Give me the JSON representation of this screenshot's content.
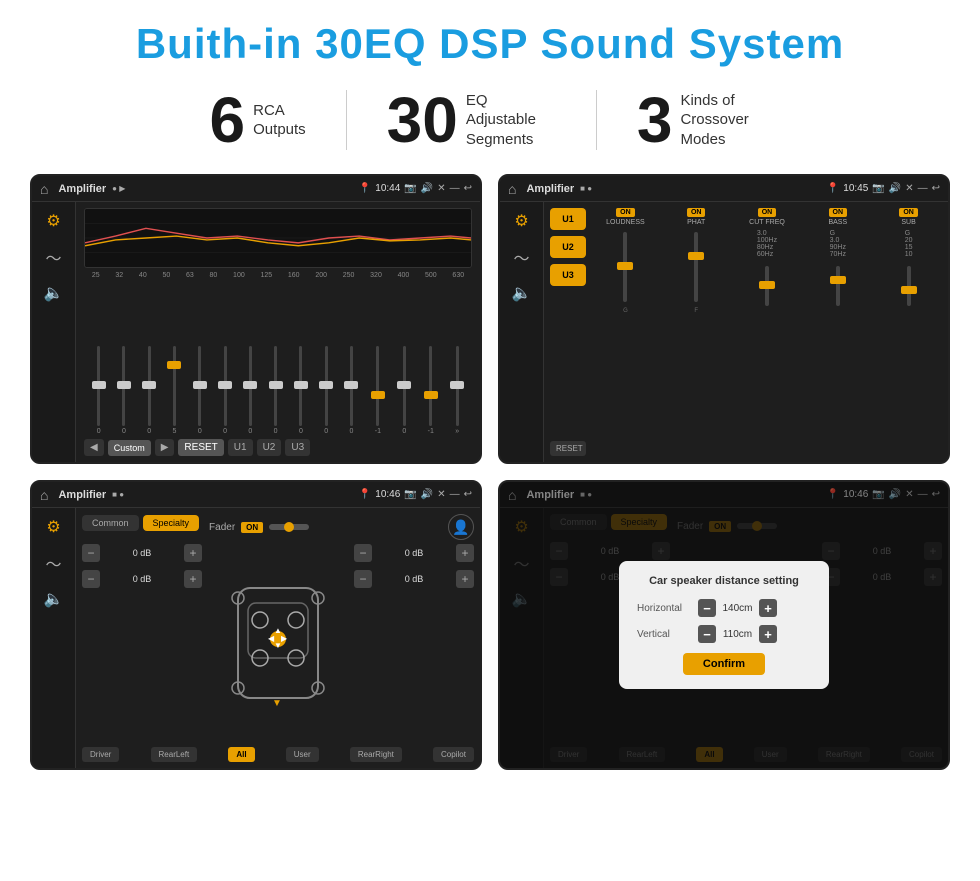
{
  "page": {
    "title": "Buith-in 30EQ DSP Sound System",
    "stats": [
      {
        "number": "6",
        "label": "RCA\nOutputs"
      },
      {
        "number": "30",
        "label": "EQ Adjustable\nSegments"
      },
      {
        "number": "3",
        "label": "Kinds of\nCrossover Modes"
      }
    ],
    "screens": [
      {
        "id": "eq-screen",
        "topbar": {
          "title": "Amplifier",
          "time": "10:44"
        },
        "type": "eq"
      },
      {
        "id": "amp-screen",
        "topbar": {
          "title": "Amplifier",
          "time": "10:45"
        },
        "type": "amp"
      },
      {
        "id": "fader-screen",
        "topbar": {
          "title": "Amplifier",
          "time": "10:46"
        },
        "type": "fader"
      },
      {
        "id": "dialog-screen",
        "topbar": {
          "title": "Amplifier",
          "time": "10:46"
        },
        "type": "dialog",
        "dialog": {
          "title": "Car speaker distance setting",
          "horizontal_label": "Horizontal",
          "horizontal_value": "140cm",
          "vertical_label": "Vertical",
          "vertical_value": "110cm",
          "confirm_label": "Confirm"
        }
      }
    ],
    "eq": {
      "freq_labels": [
        "25",
        "32",
        "40",
        "50",
        "63",
        "80",
        "100",
        "125",
        "160",
        "200",
        "250",
        "320",
        "400",
        "500",
        "630"
      ],
      "values": [
        "0",
        "0",
        "0",
        "5",
        "0",
        "0",
        "0",
        "0",
        "0",
        "0",
        "0",
        "-1",
        "0",
        "-1"
      ],
      "buttons": [
        "Custom",
        "RESET",
        "U1",
        "U2",
        "U3"
      ]
    },
    "amp": {
      "presets": [
        "U1",
        "U2",
        "U3"
      ],
      "controls": [
        {
          "name": "LOUDNESS",
          "on": true
        },
        {
          "name": "PHAT",
          "on": true
        },
        {
          "name": "CUT FREQ",
          "on": true
        },
        {
          "name": "BASS",
          "on": true
        },
        {
          "name": "SUB",
          "on": true
        }
      ],
      "reset_label": "RESET"
    },
    "fader": {
      "tabs": [
        "Common",
        "Specialty"
      ],
      "fader_label": "Fader",
      "on_label": "ON",
      "db_values": [
        "0 dB",
        "0 dB",
        "0 dB",
        "0 dB"
      ],
      "buttons": [
        "Driver",
        "RearLeft",
        "All",
        "User",
        "RearRight",
        "Copilot"
      ]
    },
    "dialog": {
      "title": "Car speaker distance setting",
      "horizontal_label": "Horizontal",
      "horizontal_value": "140cm",
      "vertical_label": "Vertical",
      "vertical_value": "110cm",
      "confirm_label": "Confirm"
    }
  }
}
